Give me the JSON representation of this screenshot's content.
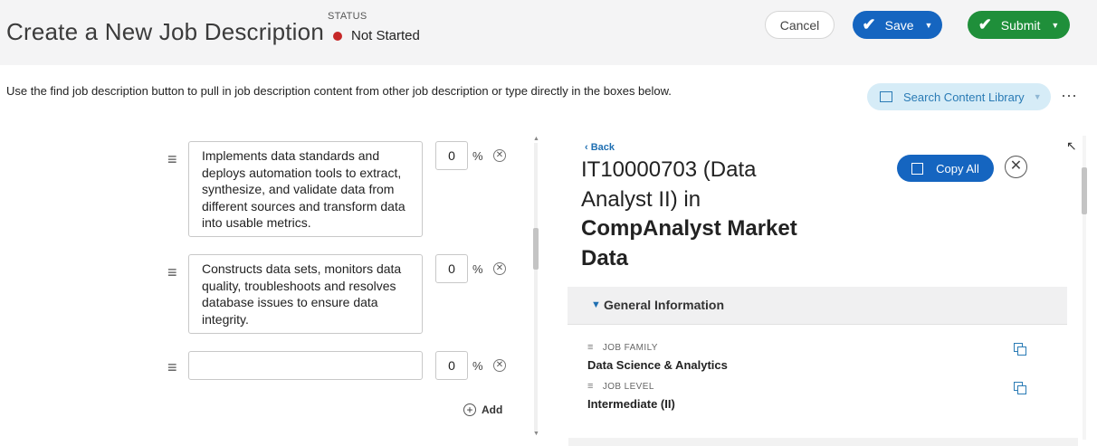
{
  "header": {
    "title": "Create a New Job Description",
    "status_label": "STATUS",
    "status_value": "Not Started",
    "status_color": "#c62828",
    "cancel_label": "Cancel",
    "save_label": "Save",
    "submit_label": "Submit"
  },
  "instructions": "Use the find job description button to pull in job description content from other job description or type directly in the boxes below.",
  "toolbar": {
    "search_library_label": "Search Content Library",
    "more_icon": "⋯"
  },
  "duties": [
    {
      "text": "Implements data standards and deploys automation tools to extract, synthesize, and validate data from different sources and transform data into usable metrics.",
      "percent": "0",
      "percent_sign": "%"
    },
    {
      "text": " Constructs data sets, monitors data quality, troubleshoots and resolves database issues to ensure data integrity.",
      "percent": "0",
      "percent_sign": "%"
    },
    {
      "text": "",
      "percent": "0",
      "percent_sign": "%"
    }
  ],
  "add_label": "Add",
  "panel": {
    "back_label": "Back",
    "job_title_line1": "IT10000703 (Data Analyst II) in",
    "job_title_bold": "CompAnalyst Market Data",
    "copy_all_label": "Copy All",
    "section_title": "General Information",
    "fields": [
      {
        "label": "JOB FAMILY",
        "value": "Data Science & Analytics"
      },
      {
        "label": "JOB LEVEL",
        "value": "Intermediate (II)"
      }
    ]
  },
  "colors": {
    "primary_blue": "#1565c0",
    "submit_green": "#1f8f3a",
    "light_blue": "#d6ecf7",
    "link_blue": "#1f6fb2"
  }
}
